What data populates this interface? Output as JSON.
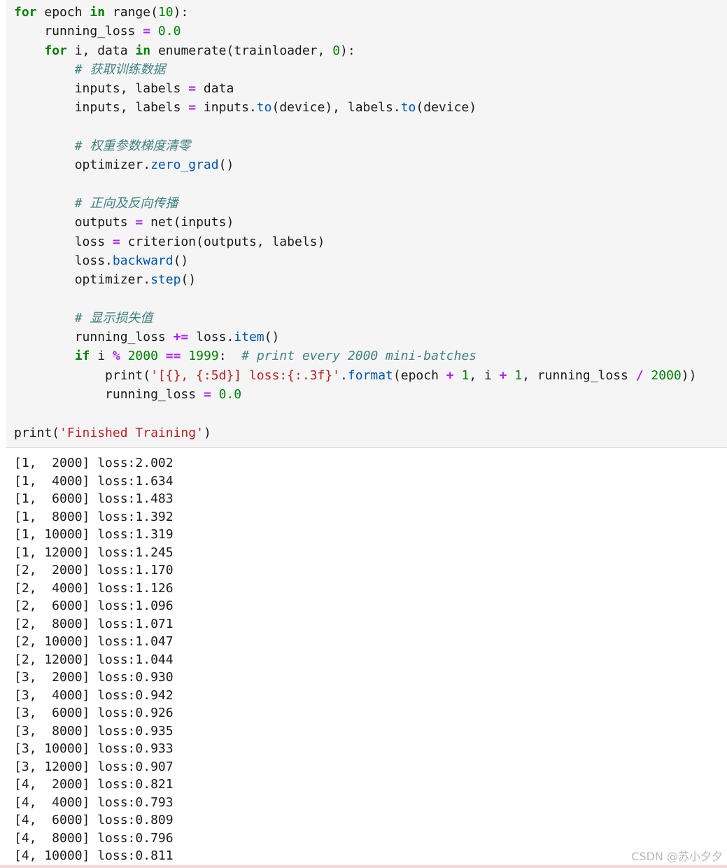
{
  "code_lines": [
    [
      [
        "kw",
        "for"
      ],
      [
        "t",
        " epoch "
      ],
      [
        "kw",
        "in"
      ],
      [
        "t",
        " range("
      ],
      [
        "num",
        "10"
      ],
      [
        "t",
        "):"
      ]
    ],
    [
      [
        "t",
        "    running_loss "
      ],
      [
        "op",
        "="
      ],
      [
        "t",
        " "
      ],
      [
        "num",
        "0.0"
      ]
    ],
    [
      [
        "t",
        "    "
      ],
      [
        "kw",
        "for"
      ],
      [
        "t",
        " i, data "
      ],
      [
        "kw",
        "in"
      ],
      [
        "t",
        " enumerate(trainloader, "
      ],
      [
        "num",
        "0"
      ],
      [
        "t",
        "):"
      ]
    ],
    [
      [
        "t",
        "        "
      ],
      [
        "cm",
        "# "
      ],
      [
        "cmcjk",
        "获取训练数据"
      ]
    ],
    [
      [
        "t",
        "        inputs, labels "
      ],
      [
        "op",
        "="
      ],
      [
        "t",
        " data"
      ]
    ],
    [
      [
        "t",
        "        inputs, labels "
      ],
      [
        "op",
        "="
      ],
      [
        "t",
        " inputs."
      ],
      [
        "attr",
        "to"
      ],
      [
        "t",
        "(device), labels."
      ],
      [
        "attr",
        "to"
      ],
      [
        "t",
        "(device)"
      ]
    ],
    [],
    [
      [
        "t",
        "        "
      ],
      [
        "cm",
        "# "
      ],
      [
        "cmcjk",
        "权重参数梯度清零"
      ]
    ],
    [
      [
        "t",
        "        optimizer."
      ],
      [
        "attr",
        "zero_grad"
      ],
      [
        "t",
        "()"
      ]
    ],
    [],
    [
      [
        "t",
        "        "
      ],
      [
        "cm",
        "# "
      ],
      [
        "cmcjk",
        "正向及反向传播"
      ]
    ],
    [
      [
        "t",
        "        outputs "
      ],
      [
        "op",
        "="
      ],
      [
        "t",
        " net(inputs)"
      ]
    ],
    [
      [
        "t",
        "        loss "
      ],
      [
        "op",
        "="
      ],
      [
        "t",
        " criterion(outputs, labels)"
      ]
    ],
    [
      [
        "t",
        "        loss."
      ],
      [
        "attr",
        "backward"
      ],
      [
        "t",
        "()"
      ]
    ],
    [
      [
        "t",
        "        optimizer."
      ],
      [
        "attr",
        "step"
      ],
      [
        "t",
        "()"
      ]
    ],
    [],
    [
      [
        "t",
        "        "
      ],
      [
        "cm",
        "# "
      ],
      [
        "cmcjk",
        "显示损失值"
      ]
    ],
    [
      [
        "t",
        "        running_loss "
      ],
      [
        "op",
        "+="
      ],
      [
        "t",
        " loss."
      ],
      [
        "attr",
        "item"
      ],
      [
        "t",
        "()"
      ]
    ],
    [
      [
        "t",
        "        "
      ],
      [
        "kw",
        "if"
      ],
      [
        "t",
        " i "
      ],
      [
        "op",
        "%"
      ],
      [
        "t",
        " "
      ],
      [
        "num",
        "2000"
      ],
      [
        "t",
        " "
      ],
      [
        "op",
        "=="
      ],
      [
        "t",
        " "
      ],
      [
        "num",
        "1999"
      ],
      [
        "t",
        ":  "
      ],
      [
        "cm",
        "# print every 2000 mini-batches"
      ]
    ],
    [
      [
        "t",
        "            print("
      ],
      [
        "str",
        "'[{}, {:5d}] loss:{:.3f}'"
      ],
      [
        "t",
        "."
      ],
      [
        "attr",
        "format"
      ],
      [
        "t",
        "(epoch "
      ],
      [
        "op",
        "+"
      ],
      [
        "t",
        " "
      ],
      [
        "num",
        "1"
      ],
      [
        "t",
        ", i "
      ],
      [
        "op",
        "+"
      ],
      [
        "t",
        " "
      ],
      [
        "num",
        "1"
      ],
      [
        "t",
        ", running_loss "
      ],
      [
        "op",
        "/"
      ],
      [
        "t",
        " "
      ],
      [
        "num",
        "2000"
      ],
      [
        "t",
        "))"
      ]
    ],
    [
      [
        "t",
        "            running_loss "
      ],
      [
        "op",
        "="
      ],
      [
        "t",
        " "
      ],
      [
        "num",
        "0.0"
      ]
    ],
    [],
    [
      [
        "t",
        "print("
      ],
      [
        "str",
        "'Finished Training'"
      ],
      [
        "t",
        ")"
      ]
    ]
  ],
  "output_lines": [
    "[1,  2000] loss:2.002",
    "[1,  4000] loss:1.634",
    "[1,  6000] loss:1.483",
    "[1,  8000] loss:1.392",
    "[1, 10000] loss:1.319",
    "[1, 12000] loss:1.245",
    "[2,  2000] loss:1.170",
    "[2,  4000] loss:1.126",
    "[2,  6000] loss:1.096",
    "[2,  8000] loss:1.071",
    "[2, 10000] loss:1.047",
    "[2, 12000] loss:1.044",
    "[3,  2000] loss:0.930",
    "[3,  4000] loss:0.942",
    "[3,  6000] loss:0.926",
    "[3,  8000] loss:0.935",
    "[3, 10000] loss:0.933",
    "[3, 12000] loss:0.907",
    "[4,  2000] loss:0.821",
    "[4,  4000] loss:0.793",
    "[4,  6000] loss:0.809",
    "[4,  8000] loss:0.796",
    "[4, 10000] loss:0.811"
  ],
  "watermark": "CSDN @苏小夕夕",
  "colors": {
    "keyword": "#008000",
    "operator": "#aa22ff",
    "number": "#008000",
    "string": "#ba2121",
    "attribute": "#0055aa",
    "comment": "#408080",
    "cell_background": "#f5f5f5"
  }
}
